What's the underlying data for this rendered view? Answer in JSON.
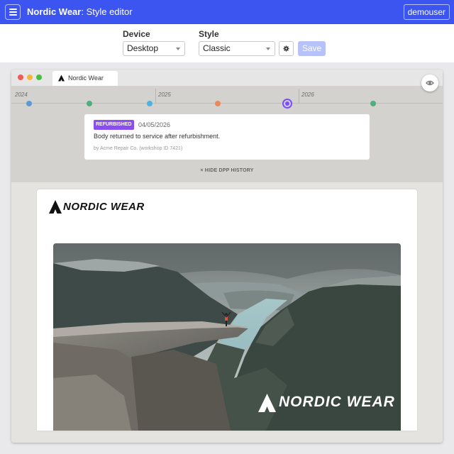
{
  "app": {
    "brand": "Nordic Wear",
    "title_suffix": ": Style editor",
    "user": "demouser"
  },
  "toolbar": {
    "device_label": "Device",
    "device_value": "Desktop",
    "style_label": "Style",
    "style_value": "Classic",
    "save_label": "Save"
  },
  "preview": {
    "tab_title": "Nordic Wear",
    "timeline": {
      "years": [
        "2024",
        "2025",
        "2026"
      ],
      "events": [
        {
          "color": "#5b9bd5"
        },
        {
          "color": "#4caf7d"
        },
        {
          "color": "#4fb3e0"
        },
        {
          "color": "#e88a5a"
        },
        {
          "color": "#7c4dff",
          "selected": true
        },
        {
          "color": "#4caf7d"
        }
      ]
    },
    "event_card": {
      "badge": "REFURBISHED",
      "date": "04/05/2026",
      "description": "Body returned to service after refurbishment.",
      "byline": "by Acme Repair Co. (workshop ID 7421)"
    },
    "hide_history": "× HIDE DPP HISTORY",
    "logo_text": "NORDIC WEAR",
    "hero_logo_text": "NORDIC WEAR"
  },
  "colors": {
    "topbar": "#3d55f0",
    "accent": "#7c4dff",
    "save_disabled": "#b7c2fb"
  }
}
